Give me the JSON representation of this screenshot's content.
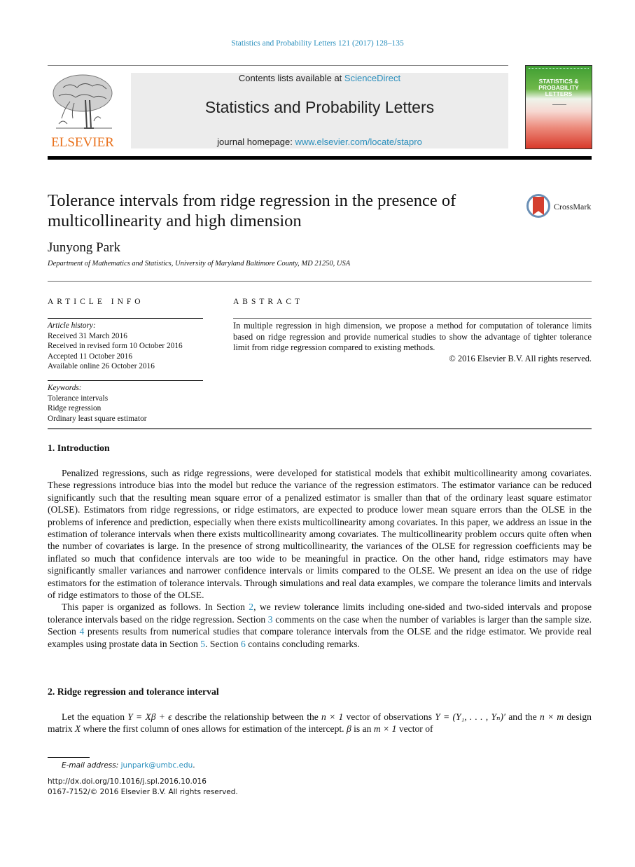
{
  "header": {
    "journal_ref": "Statistics and Probability Letters 121 (2017) 128–135",
    "publisher_logo": "ELSEVIER",
    "contents_prefix": "Contents lists available at ",
    "contents_link": "ScienceDirect",
    "journal_title": "Statistics and Probability Letters",
    "homepage_prefix": "journal homepage: ",
    "homepage_link": "www.elsevier.com/locate/stapro",
    "cover_title_1": "STATISTICS &",
    "cover_title_2": "PROBABILITY",
    "cover_title_3": "LETTERS",
    "colors": {
      "link": "#2a8fbd",
      "elsevier_orange": "#e9711c"
    }
  },
  "article": {
    "title": "Tolerance intervals from ridge regression in the presence of multicollinearity and high dimension",
    "crossmark_label": "CrossMark",
    "author": "Junyong Park",
    "affiliation": "Department of Mathematics and Statistics, University of Maryland Baltimore County, MD 21250, USA"
  },
  "article_info": {
    "heading": "ARTICLE INFO",
    "history_label": "Article history:",
    "history": [
      "Received 31 March 2016",
      "Received in revised form 10 October 2016",
      "Accepted 11 October 2016",
      "Available online 26 October 2016"
    ],
    "keywords_label": "Keywords:",
    "keywords": [
      "Tolerance intervals",
      "Ridge regression",
      "Ordinary least square estimator"
    ]
  },
  "abstract": {
    "heading": "ABSTRACT",
    "text": "In multiple regression in high dimension, we propose a method for computation of tolerance limits based on ridge regression and provide numerical studies to show the advantage of tighter tolerance limit from ridge regression compared to existing methods.",
    "copyright": "© 2016 Elsevier B.V. All rights reserved."
  },
  "sections": {
    "intro": {
      "heading": "1.  Introduction",
      "p1": "Penalized regressions, such as ridge regressions, were developed for statistical models that exhibit multicollinearity among covariates. These regressions introduce bias into the model but reduce the variance of the regression estimators. The estimator variance can be reduced significantly such that the resulting mean square error of a penalized estimator is smaller than that of the ordinary least square estimator (OLSE). Estimators from ridge regressions, or ridge estimators, are expected to produce lower mean square errors than the OLSE in the problems of inference and prediction, especially when there exists multicollinearity among covariates. In this paper, we address an issue in the estimation of tolerance intervals when there exists multicollinearity among covariates. The multicollinearity problem occurs quite often when the number of covariates is large. In the presence of strong multicollinearity, the variances of the OLSE for regression coefficients may be inflated so much that confidence intervals are too wide to be meaningful in practice. On the other hand, ridge estimators may have significantly smaller variances and narrower confidence intervals or limits compared to the OLSE. We present an idea on the use of ridge estimators for the estimation of tolerance intervals. Through simulations and real data examples, we compare the tolerance limits and intervals of ridge estimators to those of the OLSE.",
      "p2_a": "This paper is organized as follows. In Section ",
      "p2_ref1": "2",
      "p2_b": ", we review tolerance limits including one-sided and two-sided intervals and propose tolerance intervals based on the ridge regression. Section ",
      "p2_ref2": "3",
      "p2_c": " comments on the case when the number of variables is larger than the sample size. Section ",
      "p2_ref3": "4",
      "p2_d": " presents results from numerical studies that compare tolerance intervals from the OLSE and the ridge estimator. We provide real examples using prostate data in Section ",
      "p2_ref4": "5",
      "p2_e": ". Section ",
      "p2_ref5": "6",
      "p2_f": " contains concluding remarks."
    },
    "ridge": {
      "heading": "2.  Ridge regression and tolerance interval",
      "p1_a": "Let the equation ",
      "p1_eq1": "Y = Xβ + ϵ",
      "p1_b": " describe the relationship between the ",
      "p1_eq2": "n × 1",
      "p1_c": " vector of observations ",
      "p1_eq3": "Y = (Y₁, . . . , Yₙ)′",
      "p1_d": " and the ",
      "p1_eq4": "n × m",
      "p1_e": " design matrix ",
      "p1_eq5": "X",
      "p1_f": " where the first column of ones allows for estimation of the intercept. ",
      "p1_eq6": "β",
      "p1_g": " is an ",
      "p1_eq7": "m × 1",
      "p1_h": " vector of"
    }
  },
  "footer": {
    "email_label": "E-mail address: ",
    "email": "junpark@umbc.edu",
    "email_suffix": ".",
    "doi": "http://dx.doi.org/10.1016/j.spl.2016.10.016",
    "issn_copyright": "0167-7152/© 2016 Elsevier B.V. All rights reserved."
  }
}
